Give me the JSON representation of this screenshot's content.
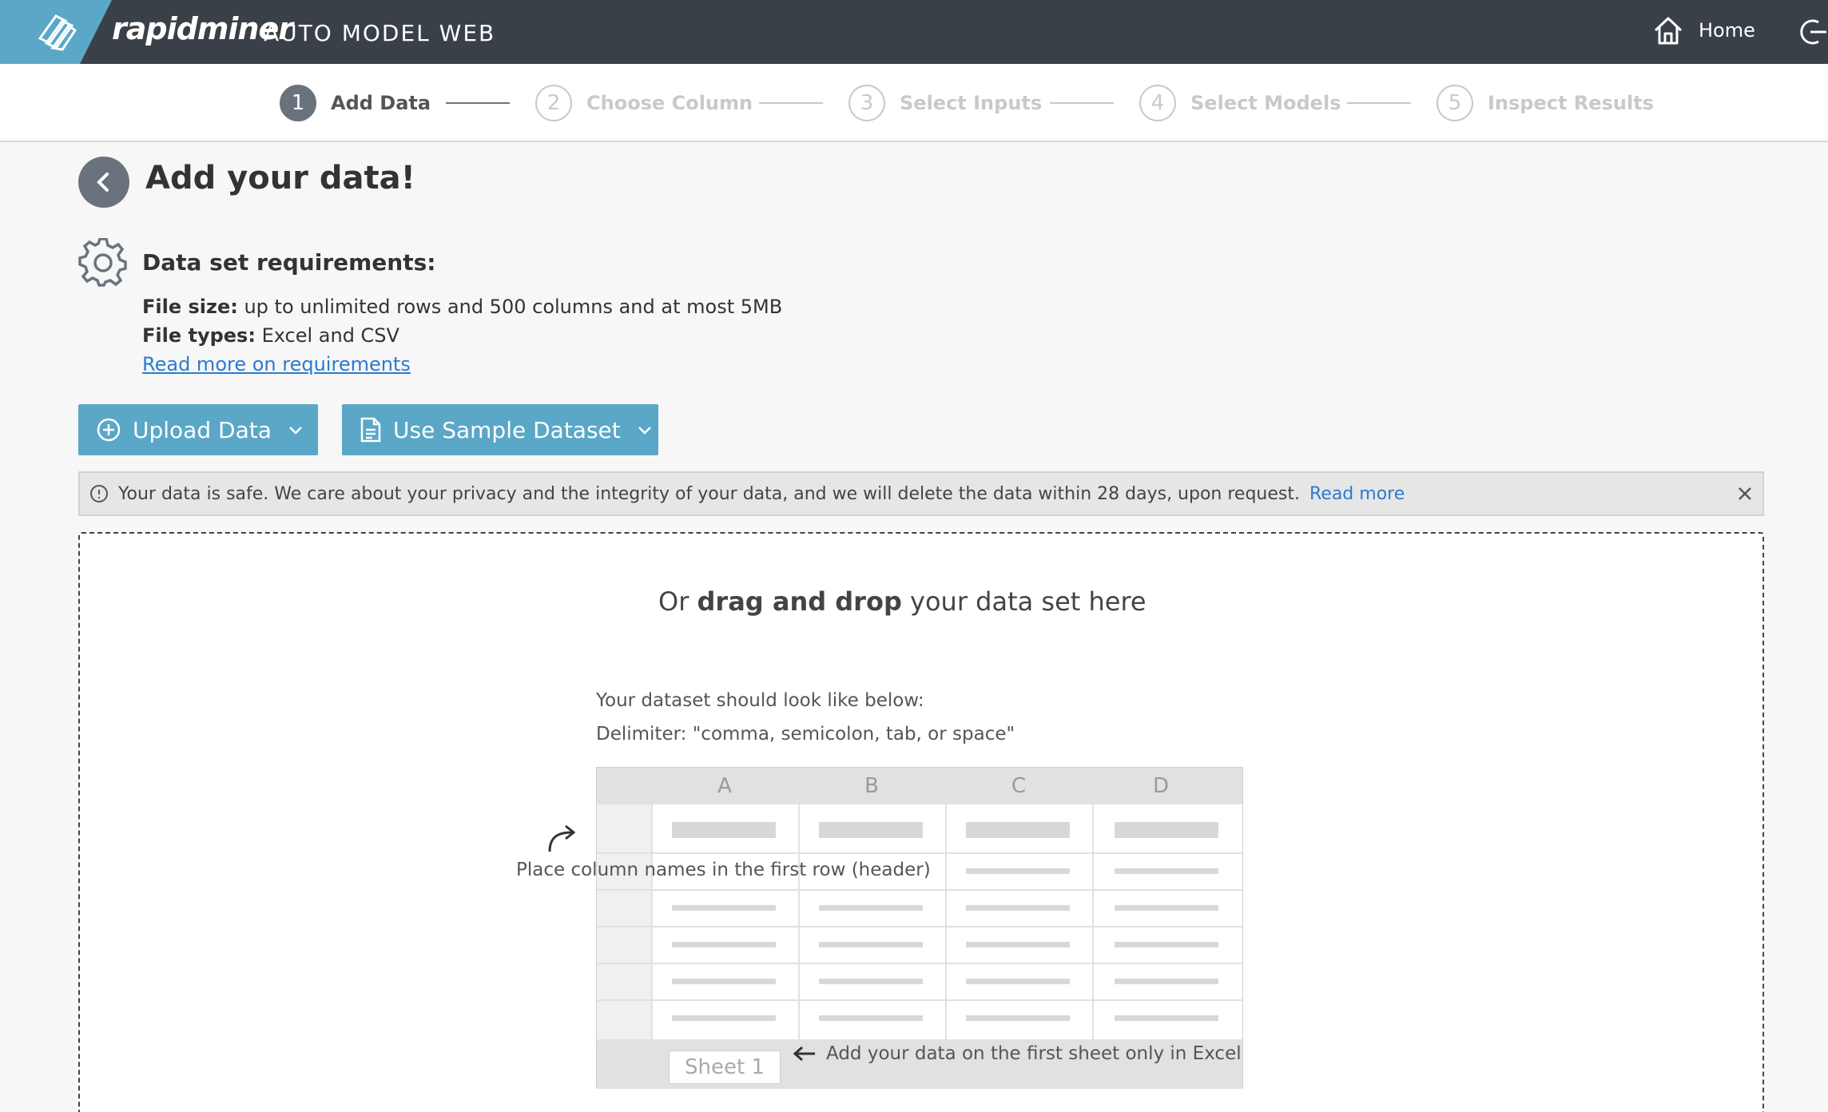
{
  "app": {
    "brand": "rapidminer",
    "product": "AUTO MODEL WEB",
    "home_label": "Home"
  },
  "stepper": {
    "steps": [
      {
        "num": "1",
        "label": "Add Data",
        "active": true
      },
      {
        "num": "2",
        "label": "Choose Column",
        "active": false
      },
      {
        "num": "3",
        "label": "Select Inputs",
        "active": false
      },
      {
        "num": "4",
        "label": "Select Models",
        "active": false
      },
      {
        "num": "5",
        "label": "Inspect Results",
        "active": false
      }
    ]
  },
  "page": {
    "title": "Add your data!"
  },
  "requirements": {
    "title": "Data set requirements:",
    "size_label": "File size:",
    "size_value": " up to unlimited rows and 500 columns and at most 5MB",
    "types_label": "File types:",
    "types_value": " Excel and CSV",
    "link": "Read more on requirements"
  },
  "buttons": {
    "upload": "Upload Data",
    "sample": "Use Sample Dataset"
  },
  "notice": {
    "text": "Your data is safe. We care about your privacy and the integrity of your data, and we will delete the data within 28 days, upon request.",
    "link": "Read more"
  },
  "dropzone": {
    "prefix": "Or ",
    "bold": "drag and drop",
    "suffix": " your data set here",
    "hint1": "Your dataset should look like below:",
    "hint2": "Delimiter: \"comma, semicolon, tab, or space\"",
    "columns": [
      "A",
      "B",
      "C",
      "D"
    ],
    "header_note": "Place column names in the first row (header)",
    "sheet_tab": "Sheet 1",
    "sheet_note": "Add your data on the first sheet only in Excel"
  },
  "colors": {
    "topbar": "#3a4047",
    "accent": "#5aa7c7",
    "link": "#2c7bd0"
  }
}
